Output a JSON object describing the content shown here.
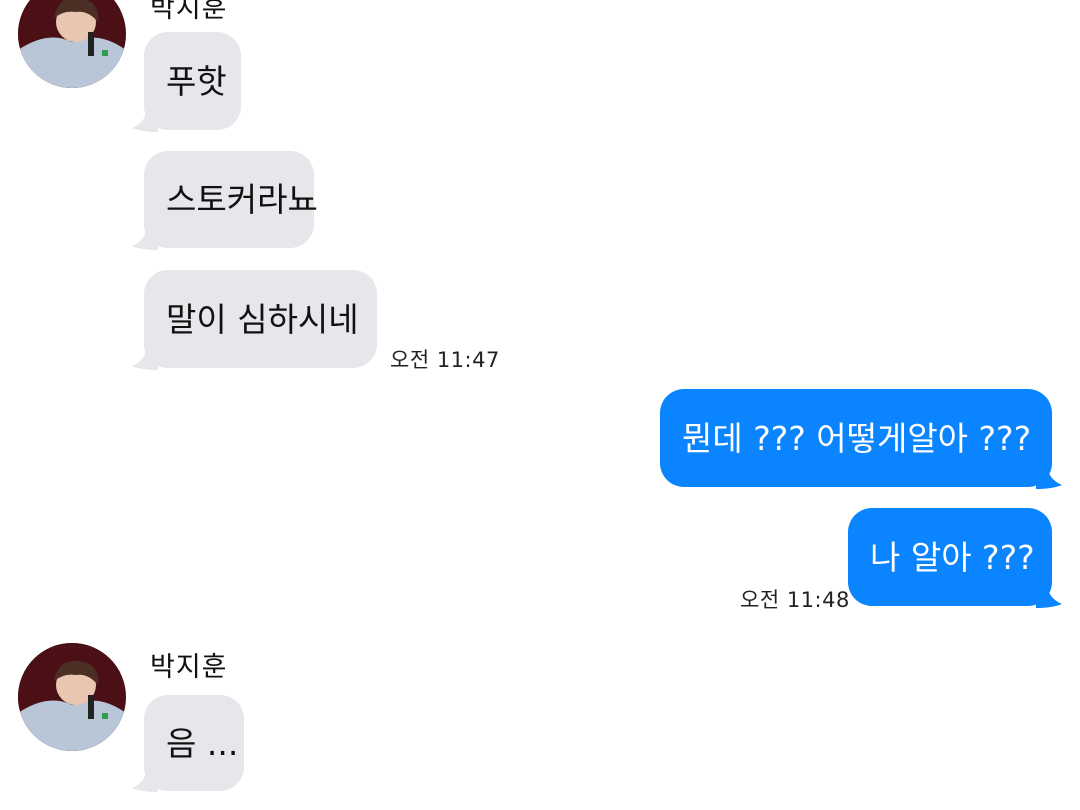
{
  "conversation": {
    "contact_name": "박지훈",
    "messages_group1": [
      {
        "text": "푸핫"
      },
      {
        "text": "스토커라뇨"
      },
      {
        "text": "말이 심하시네"
      }
    ],
    "time_group1": "오전 11:47",
    "my_messages": [
      {
        "text": "뭔데 ??? 어떻게알아 ???"
      },
      {
        "text": "나 알아 ???"
      }
    ],
    "time_group2": "오전 11:48",
    "messages_group2": [
      {
        "text": "음 ..."
      }
    ]
  },
  "colors": {
    "incoming_bubble": "#e6e6eb",
    "outgoing_bubble": "#0a84ff",
    "background": "#ffffff"
  },
  "icons": {
    "avatar": "profile-photo"
  }
}
